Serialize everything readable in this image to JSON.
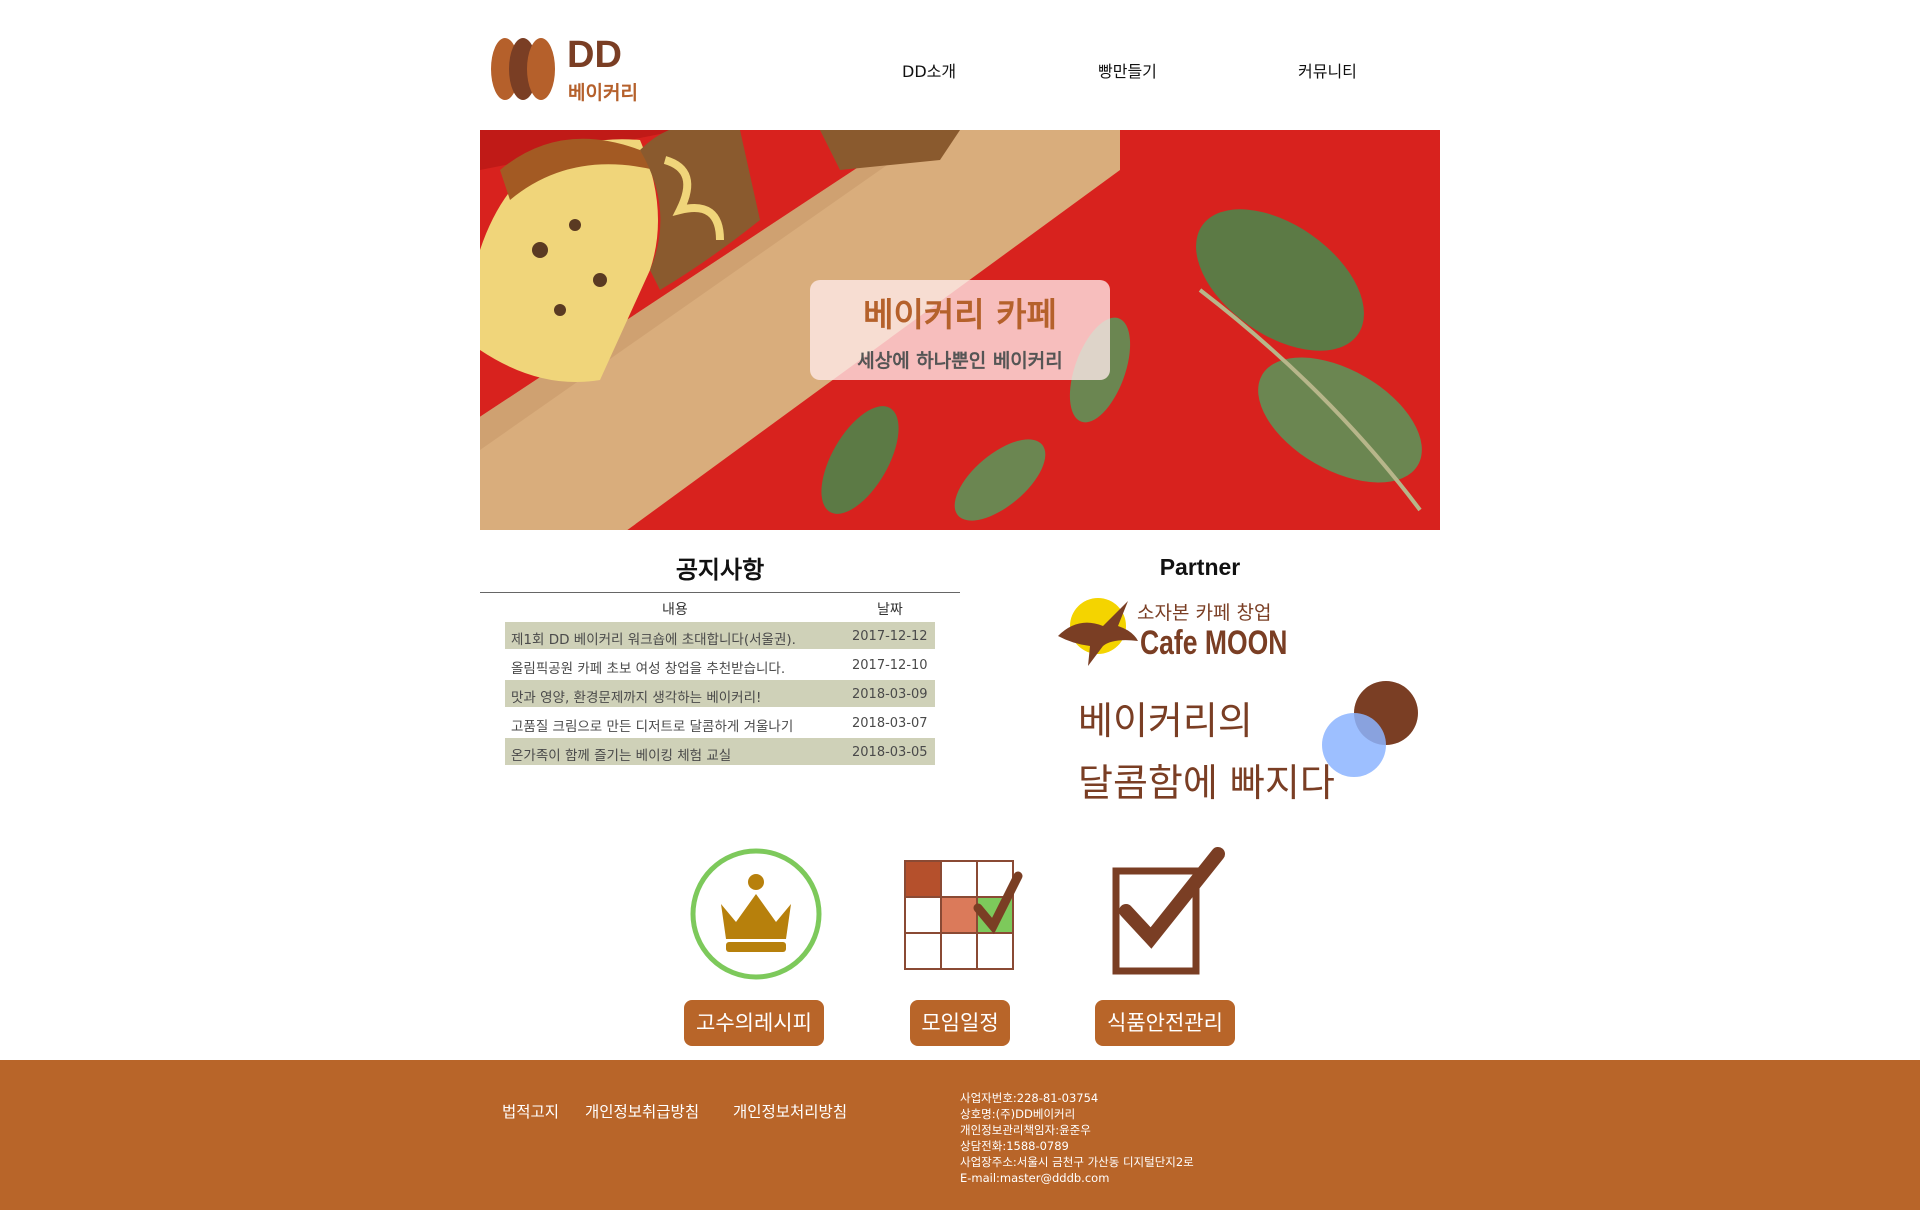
{
  "brand": {
    "name_top": "DD",
    "name_bottom": "베이커리"
  },
  "nav": {
    "items": [
      "DD소개",
      "빵만들기",
      "커뮤니티"
    ]
  },
  "hero": {
    "title": "베이커리 카페",
    "subtitle": "세상에 하나뿐인 베이커리"
  },
  "notice": {
    "title": "공지사항",
    "headers": [
      "내용",
      "날짜"
    ],
    "rows": [
      {
        "text": "제1회 DD 베이커리 워크숍에 초대합니다(서울권).",
        "date": "2017-12-12"
      },
      {
        "text": "올림픽공원 카페 초보 여성 창업을 추천받습니다.",
        "date": "2017-12-10"
      },
      {
        "text": "맛과 영양, 환경문제까지 생각하는 베이커리!",
        "date": "2018-03-09"
      },
      {
        "text": "고품질 크림으로 만든 디저트로 달콤하게 겨울나기",
        "date": "2018-03-07"
      },
      {
        "text": "온가족이 함께 즐기는 베이킹 체험 교실",
        "date": "2018-03-05"
      }
    ]
  },
  "partner": {
    "title": "Partner",
    "cafe_sub": "소자본 카페 창업",
    "cafe_name": "Cafe MOON",
    "slogan_line1": "베이커리의",
    "slogan_line2": "달콤함에 빠지다"
  },
  "features": [
    {
      "label": "고수의레시피",
      "icon": "crown-icon"
    },
    {
      "label": "모임일정",
      "icon": "calendar-check-icon"
    },
    {
      "label": "식품안전관리",
      "icon": "checkbox-icon"
    }
  ],
  "footer": {
    "links": [
      "법적고지",
      "개인정보취급방침",
      "개인정보처리방침"
    ],
    "info": [
      "사업자번호:228-81-03754",
      "상호명:(주)DD베이커리",
      "개인정보관리책임자:윤준우",
      "상담전화:1588-0789",
      "사업장주소:서울시 금천구 가산동 디지털단지2로",
      "E-mail:master@dddb.com"
    ]
  },
  "colors": {
    "brand_brown": "#7a3e24",
    "accent_orange": "#b86529",
    "notice_row": "#cfd1b8",
    "hero_red": "#d8221e"
  }
}
